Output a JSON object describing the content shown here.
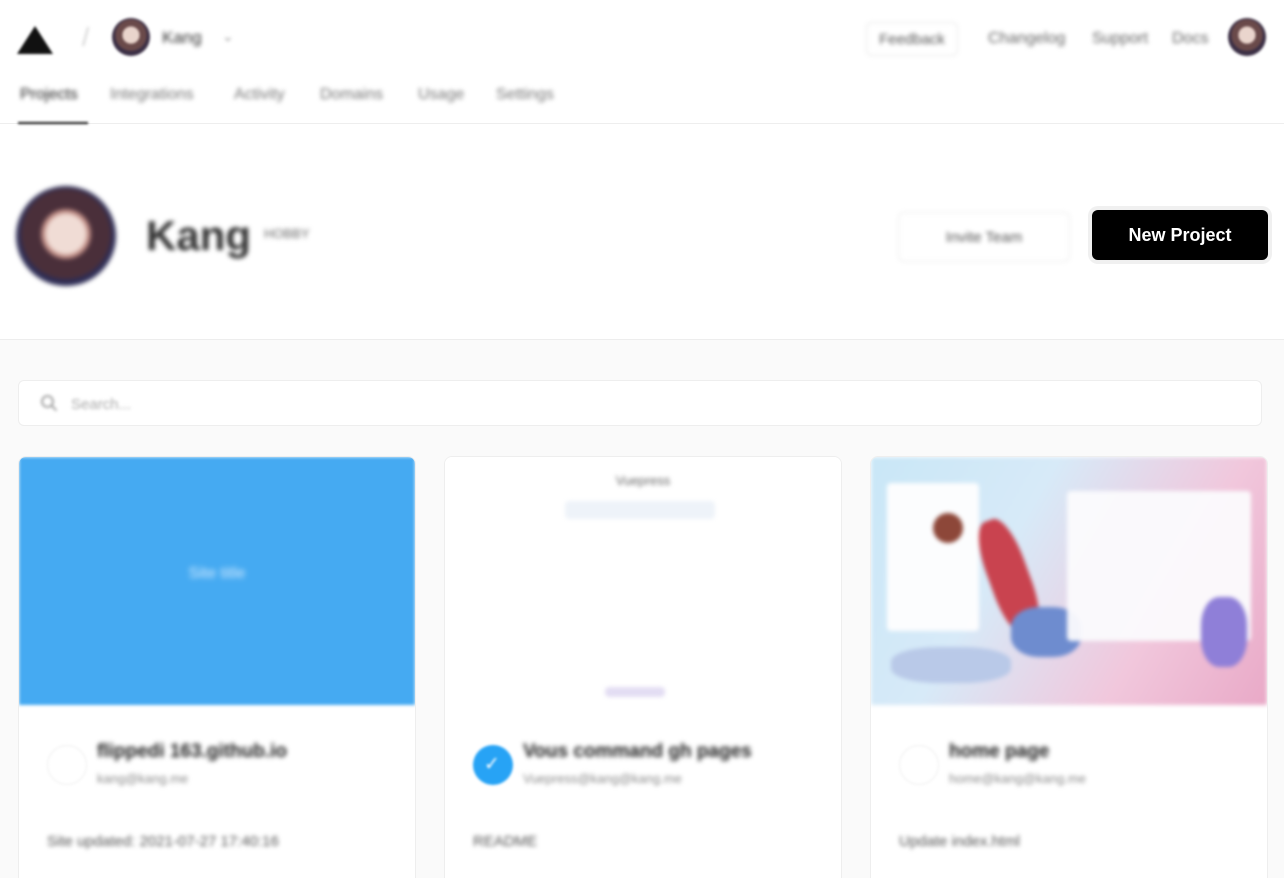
{
  "header": {
    "team_name": "Kang",
    "feedback_label": "Feedback",
    "nav_links": [
      "Changelog",
      "Support",
      "Docs"
    ]
  },
  "tabs": [
    {
      "label": "Projects",
      "active": true
    },
    {
      "label": "Integrations"
    },
    {
      "label": "Activity"
    },
    {
      "label": "Domains"
    },
    {
      "label": "Usage"
    },
    {
      "label": "Settings"
    }
  ],
  "profile": {
    "name": "Kang",
    "badge": "HOBBY"
  },
  "actions": {
    "invite_label": "Invite Team",
    "new_project_label": "New Project"
  },
  "search": {
    "placeholder": "Search..."
  },
  "projects": [
    {
      "preview_text": "Site title",
      "title": "flippedi 163.github.io",
      "subtitle": "kang@kang.me",
      "meta": "Site updated: 2021-07-27 17:40:16"
    },
    {
      "preview_title": "Vuepress",
      "title": "Vous command gh pages",
      "subtitle": "Vuepress@kang@kang.me",
      "meta": "README"
    },
    {
      "title": "home page",
      "subtitle": "home@kang@kang.me",
      "meta": "Update index.html"
    }
  ],
  "colors": {
    "accent": "#000000",
    "preview_blue": "#45aaf2",
    "check_blue": "#27a3f5"
  }
}
